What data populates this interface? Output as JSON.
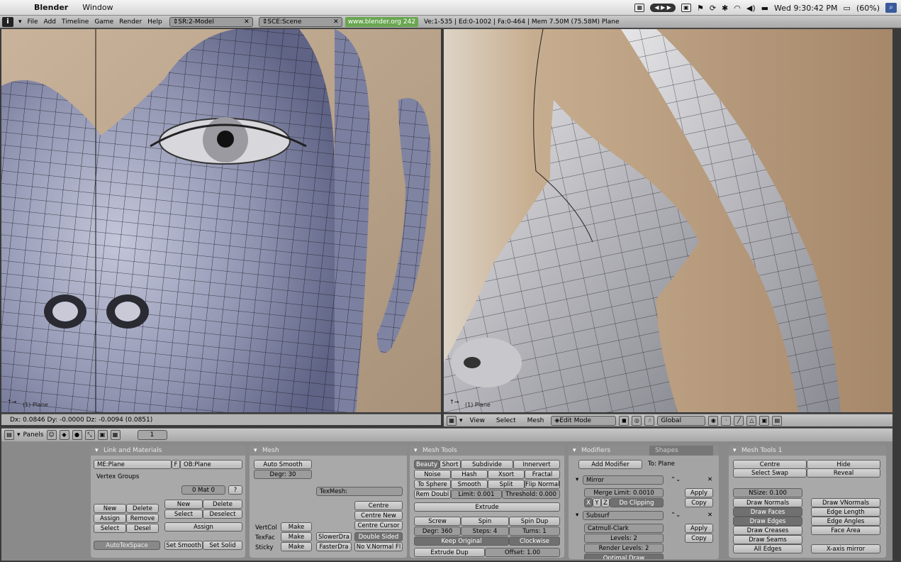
{
  "menubar": {
    "app": "Blender",
    "items": [
      "Window"
    ],
    "clock": "Wed 9:30:42 PM",
    "battery": "(60%)"
  },
  "header": {
    "menus": [
      "File",
      "Add",
      "Timeline",
      "Game",
      "Render",
      "Help"
    ],
    "screen": "SR:2-Model",
    "scene": "SCE:Scene",
    "url": "www.blender.org 242",
    "stats": "Ve:1-535 | Ed:0-1002 | Fa:0-464 | Mem 7.50M (75.58M) Plane"
  },
  "viewport_left": {
    "label": "(1) Plane",
    "status": "Dx: 0.0846   Dy: -0.0000   Dz: -0.0094 (0.0851)"
  },
  "viewport_right": {
    "label": "(1) Plane",
    "menus": [
      "View",
      "Select",
      "Mesh"
    ],
    "mode": "Edit Mode",
    "orientation": "Global"
  },
  "buttons_header": {
    "panels_label": "Panels",
    "frame": "1"
  },
  "link_materials": {
    "title": "Link and Materials",
    "me": "ME:Plane",
    "f": "F",
    "ob": "OB:Plane",
    "vertex_groups": "Vertex Groups",
    "mat": "0 Mat 0",
    "q": "?",
    "buttons": {
      "new": "New",
      "delete": "Delete",
      "assign": "Assign",
      "remove": "Remove",
      "select": "Select",
      "desel": "Desel",
      "new2": "New",
      "delete2": "Delete",
      "select2": "Select",
      "deselect": "Deselect",
      "assign2": "Assign",
      "autotexspace": "AutoTexSpace",
      "set_smooth": "Set Smooth",
      "set_solid": "Set Solid"
    }
  },
  "mesh": {
    "title": "Mesh",
    "auto_smooth": "Auto Smooth",
    "degr": "Degr: 30",
    "texmesh": "TexMesh:",
    "centre": "Centre",
    "centre_new": "Centre New",
    "centre_cursor": "Centre Cursor",
    "vertcol": "VertCol",
    "texface": "TexFac",
    "sticky": "Sticky",
    "make": "Make",
    "slowerdraw": "SlowerDra",
    "fasterdraw": "FasterDra",
    "double_sided": "Double Sided",
    "no_vnormal": "No V.Normal Fl"
  },
  "mesh_tools": {
    "title": "Mesh Tools",
    "row1": [
      "Beauty",
      "Short",
      "Subdivide",
      "Innervert"
    ],
    "row2": [
      "Noise",
      "Hash",
      "Xsort",
      "Fractal"
    ],
    "row3": [
      "To Sphere",
      "Smooth",
      "Split",
      "Flip Normal"
    ],
    "rem_double": "Rem Doubl",
    "limit": "Limit: 0.001",
    "threshold": "Threshold: 0.000",
    "extrude": "Extrude",
    "screw": "Screw",
    "spin": "Spin",
    "spin_dup": "Spin Dup",
    "degr": "Degr: 360",
    "steps": "Steps: 4",
    "turns": "Turns: 1",
    "keep_original": "Keep Original",
    "clockwise": "Clockwise",
    "extrude_dup": "Extrude Dup",
    "offset": "Offset: 1.00"
  },
  "modifiers": {
    "tab_modifiers": "Modifiers",
    "tab_shapes": "Shapes",
    "add_modifier": "Add Modifier",
    "to": "To: Plane",
    "mirror": "Mirror",
    "merge_limit": "Merge Limit: 0.0010",
    "x": "X",
    "y": "Y",
    "z": "Z",
    "do_clipping": "Do Clipping",
    "apply": "Apply",
    "copy": "Copy",
    "subsurf": "Subsurf",
    "catmull": "Catmull-Clark",
    "levels": "Levels: 2",
    "render_levels": "Render Levels: 2",
    "optimal": "Optimal Draw"
  },
  "mesh_tools1": {
    "title": "Mesh Tools 1",
    "centre": "Centre",
    "hide": "Hide",
    "select_swap": "Select Swap",
    "reveal": "Reveal",
    "nsize": "NSize: 0.100",
    "draw_normals": "Draw Normals",
    "draw_faces": "Draw Faces",
    "draw_edges": "Draw Edges",
    "draw_creases": "Draw Creases",
    "draw_seams": "Draw Seams",
    "all_edges": "All Edges",
    "draw_vnormals": "Draw VNormals",
    "edge_length": "Edge Length",
    "edge_angles": "Edge Angles",
    "face_area": "Face Area",
    "x_mirror": "X-axis mirror"
  }
}
